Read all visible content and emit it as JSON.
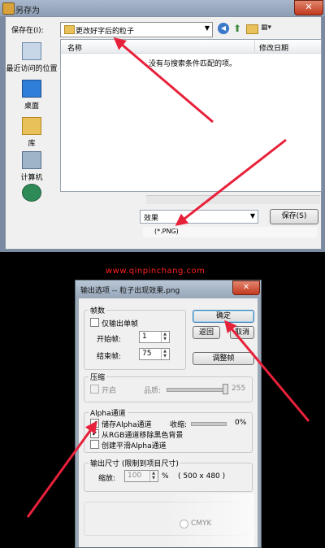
{
  "save_dialog": {
    "title": "另存为",
    "close_glyph": "✕",
    "save_in_label": "保存在(I):",
    "folder_name": "更改好字后的粒子",
    "places": [
      {
        "label": "最近访问的位置",
        "icon": "recent-places-icon"
      },
      {
        "label": "桌面",
        "icon": "desktop-icon"
      },
      {
        "label": "库",
        "icon": "library-icon"
      },
      {
        "label": "计算机",
        "icon": "computer-icon"
      },
      {
        "label": "",
        "icon": "network-icon"
      }
    ],
    "columns": {
      "name": "名称",
      "date": "修改日期"
    },
    "empty_message": "没有与搜索条件匹配的项。",
    "filename_value": "效果",
    "save_button": "保存(S)",
    "filetype": "(*.PNG)"
  },
  "watermark": "www.qinpinchang.com",
  "output_options": {
    "title": "输出选项 -- 粒子出现效果.png",
    "ok_button": "确定",
    "back_button": "返回",
    "cancel_button": "取消",
    "adjust_button": "调整帧",
    "frames": {
      "group_label": "帧数",
      "single_frame_label": "仅输出单帧",
      "start_label": "开始帧:",
      "start_value": "1",
      "end_label": "结束帧:",
      "end_value": "75"
    },
    "compression": {
      "group_label": "压缩",
      "enable_label": "开启",
      "quality_label": "品质:",
      "quality_value": "255"
    },
    "alpha": {
      "group_label": "Alpha通道",
      "save_alpha_label": "储存Alpha通道",
      "shrink_label": "收缩:",
      "shrink_value": "0%",
      "remove_black_label": "从RGB通道移除黑色背景",
      "smooth_alpha_label": "创建平滑Alpha通道",
      "checked": [
        true,
        true,
        false
      ]
    },
    "output_size": {
      "group_label": "输出尺寸  (限制到项目尺寸)",
      "scale_label": "缩放:",
      "scale_value": "100",
      "percent": "%",
      "dims": "( 500 x 480 )"
    },
    "color_mode": {
      "cmyk_label": "CMYK"
    }
  },
  "colors": {
    "arrow": "#e8213b",
    "watermark": "#ff2020"
  }
}
